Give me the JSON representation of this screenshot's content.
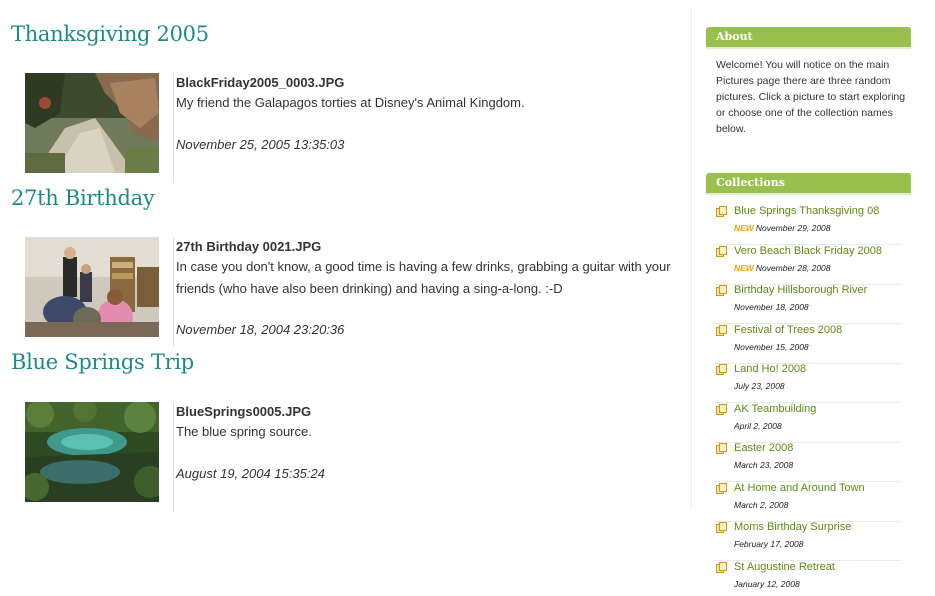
{
  "sections": [
    {
      "title": "Thanksgiving 2005",
      "filename": "BlackFriday2005_0003.JPG",
      "description": "My friend the Galapagos torties at Disney's Animal Kingdom.",
      "date": "November 25, 2005 13:35:03",
      "photo_icon": "rocky-path-photo"
    },
    {
      "title": "27th Birthday",
      "filename": "27th Birthday 0021.JPG",
      "description": "In case you don't know, a good time is having a few drinks, grabbing a guitar with your friends (who have also been drinking) and having a sing-a-long. :-D",
      "date": "November 18, 2004 23:20:36",
      "photo_icon": "party-room-photo"
    },
    {
      "title": "Blue Springs Trip",
      "filename": "BlueSprings0005.JPG",
      "description": "The blue spring source.",
      "date": "August 19, 2004 15:35:24",
      "photo_icon": "blue-spring-photo"
    }
  ],
  "sidebar": {
    "about": {
      "title": "About",
      "text": "Welcome! You will notice on the main Pictures page there are three random pictures. Click a picture to start exploring or choose one of the collection names below."
    },
    "collections": {
      "title": "Collections",
      "new_label": "NEW",
      "items": [
        {
          "name": "Blue Springs Thanksgiving 08",
          "date": "November 29, 2008",
          "is_new": true
        },
        {
          "name": "Vero Beach Black Friday 2008",
          "date": "November 28, 2008",
          "is_new": true
        },
        {
          "name": "Birthday Hillsborough River",
          "date": "November 18, 2008",
          "is_new": false
        },
        {
          "name": "Festival of Trees 2008",
          "date": "November 15, 2008",
          "is_new": false
        },
        {
          "name": "Land Ho! 2008",
          "date": "July 23, 2008",
          "is_new": false
        },
        {
          "name": "AK Teambuilding",
          "date": "April 2, 2008",
          "is_new": false
        },
        {
          "name": "Easter 2008",
          "date": "March 23, 2008",
          "is_new": false
        },
        {
          "name": "At Home and Around Town",
          "date": "March 2, 2008",
          "is_new": false
        },
        {
          "name": "Moms Birthday Surprise",
          "date": "February 17, 2008",
          "is_new": false
        },
        {
          "name": "St Augustine Retreat",
          "date": "January 12, 2008",
          "is_new": false
        }
      ]
    }
  },
  "colors": {
    "title_teal": "#1d8a8a",
    "sidebar_green": "#99bf4e",
    "link_green": "#5f8a12",
    "new_yellow": "#e6a800"
  }
}
